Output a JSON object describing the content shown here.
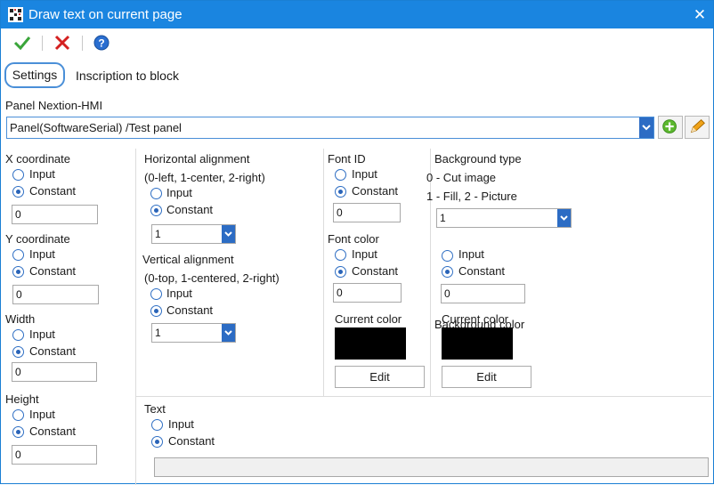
{
  "window": {
    "title": "Draw text on current page"
  },
  "toolbar": {
    "ok_icon": "checkmark-icon",
    "cancel_icon": "red-x-icon",
    "help_icon": "help-icon"
  },
  "tabs": {
    "settings": "Settings",
    "inscription": "Inscription to block"
  },
  "panel": {
    "label": "Panel Nextion-HMI",
    "selected": "Panel(SoftwareSerial) /Test panel"
  },
  "common": {
    "input": "Input",
    "constant": "Constant"
  },
  "x": {
    "label": "X coordinate",
    "value": "0"
  },
  "y": {
    "label": "Y coordinate",
    "value": "0"
  },
  "width": {
    "label": "Width",
    "value": "0"
  },
  "height": {
    "label": "Height",
    "value": "0"
  },
  "halign": {
    "label": "Horizontal alignment",
    "hint": "(0-left, 1-center, 2-right)",
    "value": "1"
  },
  "valign": {
    "label": "Vertical alignment",
    "hint": "(0-top, 1-centered, 2-right)",
    "value": "1"
  },
  "font_id": {
    "label": "Font ID",
    "value": "0"
  },
  "font_color": {
    "label": "Font color",
    "value": "0",
    "current_label": "Current color",
    "edit": "Edit",
    "swatch": "#000000"
  },
  "bg_type": {
    "label": "Background type",
    "hint1": "0 - Cut image",
    "hint2": "1 - Fill, 2 - Picture",
    "value": "1"
  },
  "bg_color": {
    "value": "0",
    "current_label": "Current color",
    "overlay_label": "Background color",
    "edit": "Edit",
    "swatch": "#000000"
  },
  "text": {
    "label": "Text",
    "value": ""
  },
  "colors": {
    "titlebar": "#1a85e0",
    "accent": "#2c6cc4"
  }
}
